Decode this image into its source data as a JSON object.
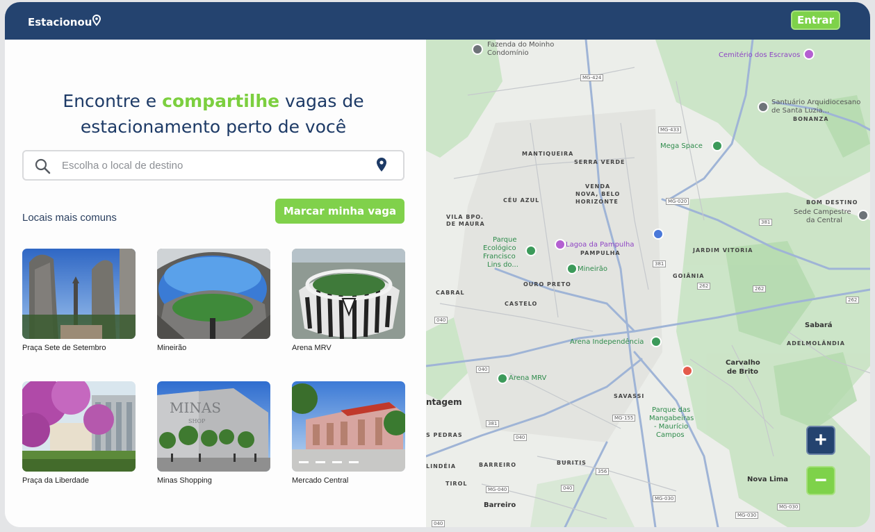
{
  "header": {
    "brand": "Estacionou",
    "login_label": "Entrar",
    "colors": {
      "bar": "#24436f",
      "accent": "#7ed24a"
    }
  },
  "hero": {
    "title_part1": "Encontre e ",
    "title_accent": "compartilhe",
    "title_part2": " vagas de",
    "title_line2": "estacionamento perto de você"
  },
  "search": {
    "placeholder": "Escolha o local de destino",
    "icon": "search-icon",
    "location_icon": "location-pin-icon"
  },
  "common": {
    "label": "Locais mais comuns",
    "mark_button": "Marcar minha vaga"
  },
  "places": [
    {
      "name": "Praça Sete de Setembro"
    },
    {
      "name": "Mineirão"
    },
    {
      "name": "Arena MRV"
    },
    {
      "name": "Praça da  Liberdade"
    },
    {
      "name": "Minas Shopping"
    },
    {
      "name": "Mercado Central"
    }
  ],
  "map": {
    "labels": [
      {
        "text": "Fazenda do Moinho"
      },
      {
        "text": "Condomínio"
      },
      {
        "text": "Cemitério dos Escravos"
      },
      {
        "text": "Santuário Arquidiocesano"
      },
      {
        "text": "de Santa Luzia..."
      },
      {
        "text": "BONANZA"
      },
      {
        "text": "Mega Space"
      },
      {
        "text": "MANTIQUEIRA"
      },
      {
        "text": "SERRA VERDE"
      },
      {
        "text": "VENDA"
      },
      {
        "text": "NOVA, BELO"
      },
      {
        "text": "HORIZONTE"
      },
      {
        "text": "CÉU AZUL"
      },
      {
        "text": "VILA BPO."
      },
      {
        "text": "DE MAURA"
      },
      {
        "text": "BOM DESTINO"
      },
      {
        "text": "Sede Campestre"
      },
      {
        "text": "da Central"
      },
      {
        "text": "Parque"
      },
      {
        "text": "Ecológico"
      },
      {
        "text": "Francisco"
      },
      {
        "text": "Lins do..."
      },
      {
        "text": "Lagoa da Pampulha"
      },
      {
        "text": "PAMPULHA"
      },
      {
        "text": "Mineirão"
      },
      {
        "text": "JARDIM VITORIA"
      },
      {
        "text": "OURO PRETO"
      },
      {
        "text": "GOIÂNIA"
      },
      {
        "text": "CABRAL"
      },
      {
        "text": "CASTELO"
      },
      {
        "text": "Sabará"
      },
      {
        "text": "ADELMOLÂNDIA"
      },
      {
        "text": "Arena Independência"
      },
      {
        "text": "Arena MRV"
      },
      {
        "text": "Carvalho"
      },
      {
        "text": "de Brito"
      },
      {
        "text": "ntagem"
      },
      {
        "text": "SAVASSI"
      },
      {
        "text": "Parque das"
      },
      {
        "text": "Mangabeiras"
      },
      {
        "text": "- Maurício"
      },
      {
        "text": "Campos"
      },
      {
        "text": "S PEDRAS"
      },
      {
        "text": "BARREIRO"
      },
      {
        "text": "BURITIS"
      },
      {
        "text": "LINDÉIA"
      },
      {
        "text": "TIROL"
      },
      {
        "text": "Nova Lima"
      },
      {
        "text": "Barreiro"
      }
    ],
    "road_shields": [
      "MG-424",
      "MG-433",
      "MG-020",
      "381",
      "381",
      "262",
      "262",
      "262",
      "040",
      "040",
      "381",
      "MG-155",
      "040",
      "356",
      "040",
      "MG-030",
      "MG-030",
      "MG-030",
      "MG-040",
      "040"
    ],
    "zoom_in": "+",
    "zoom_out": "−"
  }
}
